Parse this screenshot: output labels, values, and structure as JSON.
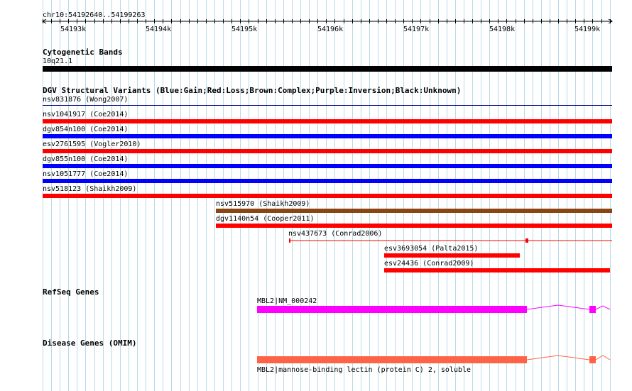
{
  "ruler": {
    "range_label": "chr10:54192640..54199263",
    "ticks": [
      "54193k",
      "54194k",
      "54195k",
      "54196k",
      "54197k",
      "54198k",
      "54199k"
    ]
  },
  "tracks": {
    "cytoband": {
      "title": "Cytogenetic Bands",
      "band_label": "10q21.1",
      "band_color": "#000000"
    },
    "dgv": {
      "title": "DGV Structural Variants (Blue:Gain;Red:Loss;Brown:Complex;Purple:Inversion;Black:Unknown)",
      "features": [
        {
          "label": "nsv831876 (Wong2007)",
          "color": "#000080"
        },
        {
          "label": "nsv1041917 (Coe2014)",
          "color": "#ff0000"
        },
        {
          "label": "dgv854n100 (Coe2014)",
          "color": "#0000ff"
        },
        {
          "label": "esv2761595 (Vogler2010)",
          "color": "#ff0000"
        },
        {
          "label": "dgv855n100 (Coe2014)",
          "color": "#0000ff"
        },
        {
          "label": "nsv1051777 (Coe2014)",
          "color": "#0000ff"
        },
        {
          "label": "nsv518123 (Shaikh2009)",
          "color": "#ff0000"
        },
        {
          "label": "nsv515970 (Shaikh2009)",
          "color": "#8b4513"
        },
        {
          "label": "dgv1140n54 (Cooper2011)",
          "color": "#ff0000"
        },
        {
          "label": "nsv437673 (Conrad2006)",
          "color": "#ff0000"
        },
        {
          "label": "esv3693054 (Palta2015)",
          "color": "#ff0000"
        },
        {
          "label": "esv24436 (Conrad2009)",
          "color": "#ff0000"
        }
      ]
    },
    "refseq": {
      "title": "RefSeq Genes",
      "gene_label": "MBL2|NM_000242",
      "color": "#ff00ff"
    },
    "omim": {
      "title": "Disease Genes (OMIM)",
      "gene_label": "MBL2|mannose-binding lectin (protein C) 2, soluble",
      "color": "#ff6347"
    }
  }
}
